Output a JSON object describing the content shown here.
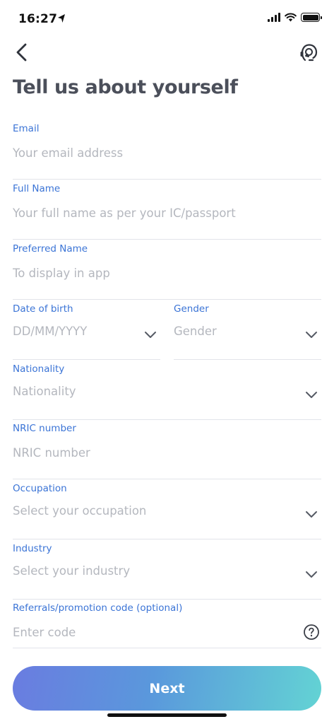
{
  "status_bar": {
    "time": "16:27"
  },
  "title": "Tell us about yourself",
  "fields": {
    "email": {
      "label": "Email",
      "placeholder": "Your email address"
    },
    "full_name": {
      "label": "Full Name",
      "placeholder": "Your full name as per your IC/passport"
    },
    "preferred_name": {
      "label": "Preferred Name",
      "placeholder": "To display in app"
    },
    "dob": {
      "label": "Date of birth",
      "placeholder": "DD/MM/YYYY"
    },
    "gender": {
      "label": "Gender",
      "placeholder": "Gender"
    },
    "nationality": {
      "label": "Nationality",
      "placeholder": "Nationality"
    },
    "nric": {
      "label": "NRIC number",
      "placeholder": "NRIC number"
    },
    "occupation": {
      "label": "Occupation",
      "placeholder": "Select your occupation"
    },
    "industry": {
      "label": "Industry",
      "placeholder": "Select your industry"
    },
    "referral": {
      "label": "Referrals/promotion code (optional)",
      "placeholder": "Enter code"
    }
  },
  "next_label": "Next",
  "colors": {
    "label": "#3b74d6",
    "placeholder": "#b4b7be",
    "title": "#4b4f5a",
    "button_gradient": [
      "#6a7ce0",
      "#63d3d4"
    ]
  },
  "icons": [
    "location-arrow-icon",
    "signal-icon",
    "wifi-icon",
    "battery-icon",
    "back-chevron-icon",
    "support-headset-icon",
    "chevron-down-icon",
    "question-circle-icon"
  ]
}
